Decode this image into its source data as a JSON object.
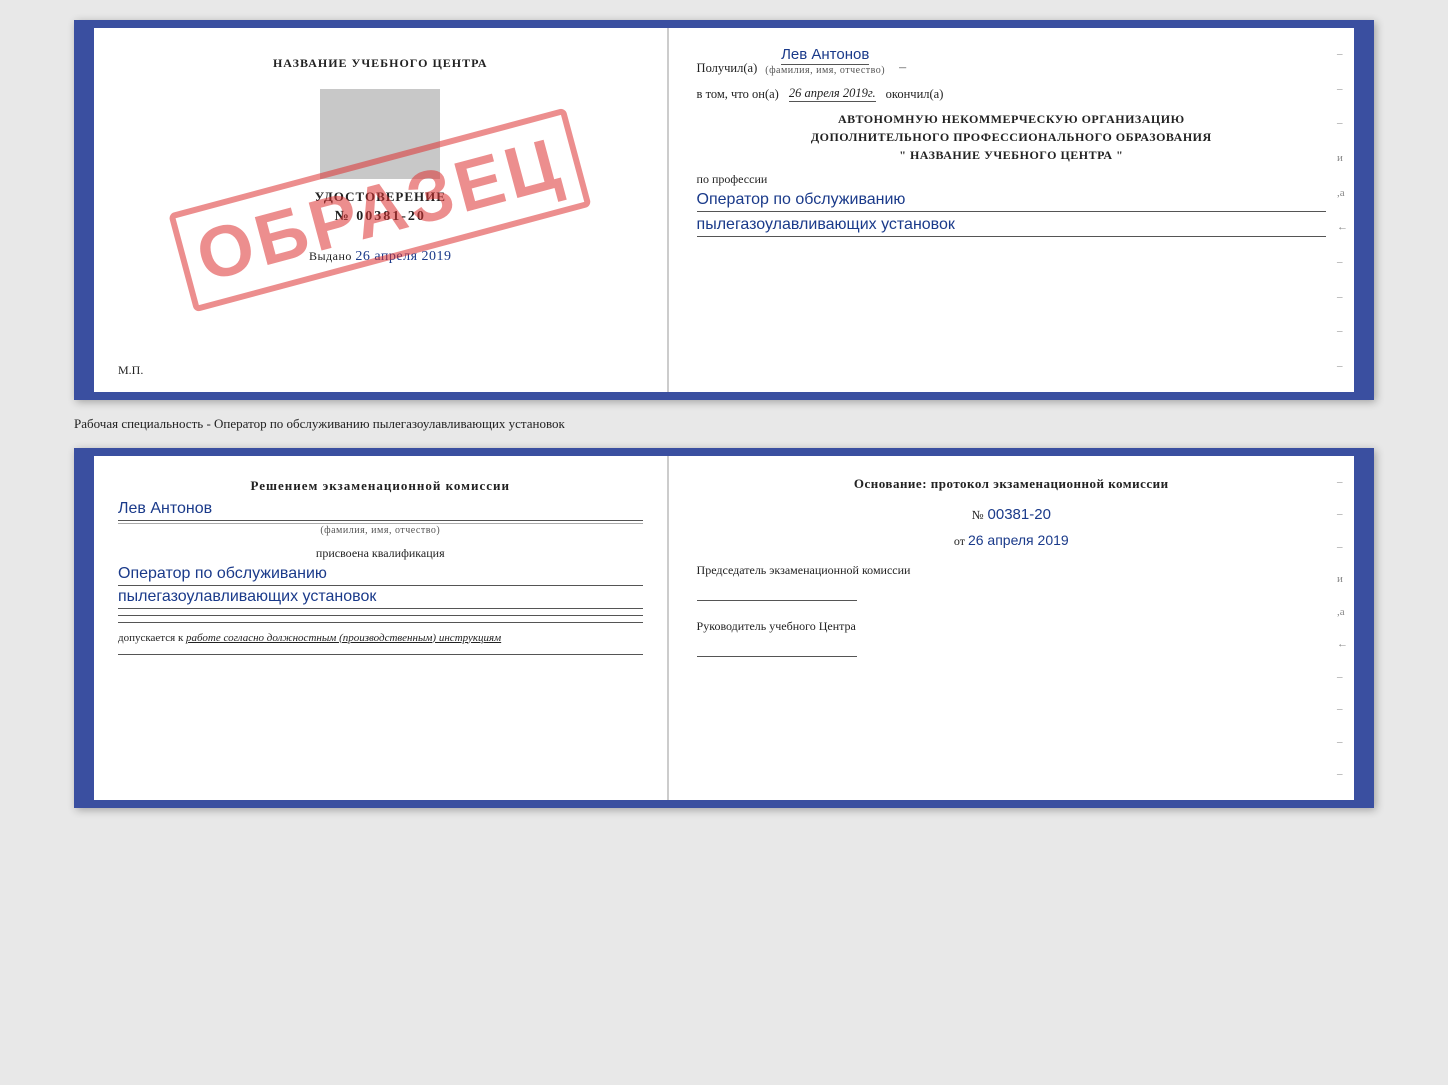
{
  "cert": {
    "left": {
      "title": "НАЗВАНИЕ УЧЕБНОГО ЦЕНТРА",
      "udostoverenie_label": "УДОСТОВЕРЕНИЕ",
      "number": "№ 00381-20",
      "vydano_label": "Выдано",
      "vydano_date": "26 апреля 2019",
      "mp": "М.П.",
      "obrazec": "ОБРАЗЕЦ"
    },
    "right": {
      "poluchil_label": "Получил(а)",
      "fio_value": "Лев Антонов",
      "fio_sub": "(фамилия, имя, отчество)",
      "vtom_label": "в том, что он(а)",
      "date_value": "26 апреля 2019г.",
      "okanchil_label": "окончил(а)",
      "org_line1": "АВТОНОМНУЮ НЕКОММЕРЧЕСКУЮ ОРГАНИЗАЦИЮ",
      "org_line2": "ДОПОЛНИТЕЛЬНОГО ПРОФЕССИОНАЛЬНОГО ОБРАЗОВАНИЯ",
      "org_line3": "\"  НАЗВАНИЕ УЧЕБНОГО ЦЕНТРА  \"",
      "po_professii": "по профессии",
      "profession_line1": "Оператор по обслуживанию",
      "profession_line2": "пылегазоулавливающих установок"
    }
  },
  "bottom_label": "Рабочая специальность - Оператор по обслуживанию пылегазоулавливающих установок",
  "qual": {
    "left": {
      "heading": "Решением экзаменационной комиссии",
      "fio_value": "Лев Антонов",
      "fio_sub": "(фамилия, имя, отчество)",
      "prisvoena": "присвоена квалификация",
      "profession_line1": "Оператор по обслуживанию",
      "profession_line2": "пылегазоулавливающих установок",
      "dopuskaetsya": "допускается к",
      "dopusk_text": "работе согласно должностным (производственным) инструкциям"
    },
    "right": {
      "heading": "Основание: протокол экзаменационной комиссии",
      "number_prefix": "№",
      "number_value": "00381-20",
      "ot_prefix": "от",
      "ot_date": "26 апреля 2019",
      "predsedatel_label": "Председатель экзаменационной комиссии",
      "rukovoditel_label": "Руководитель учебного Центра"
    }
  },
  "side_marks": [
    "-",
    "-",
    "-",
    "и",
    ",а",
    "←",
    "-",
    "-",
    "-",
    "-"
  ]
}
